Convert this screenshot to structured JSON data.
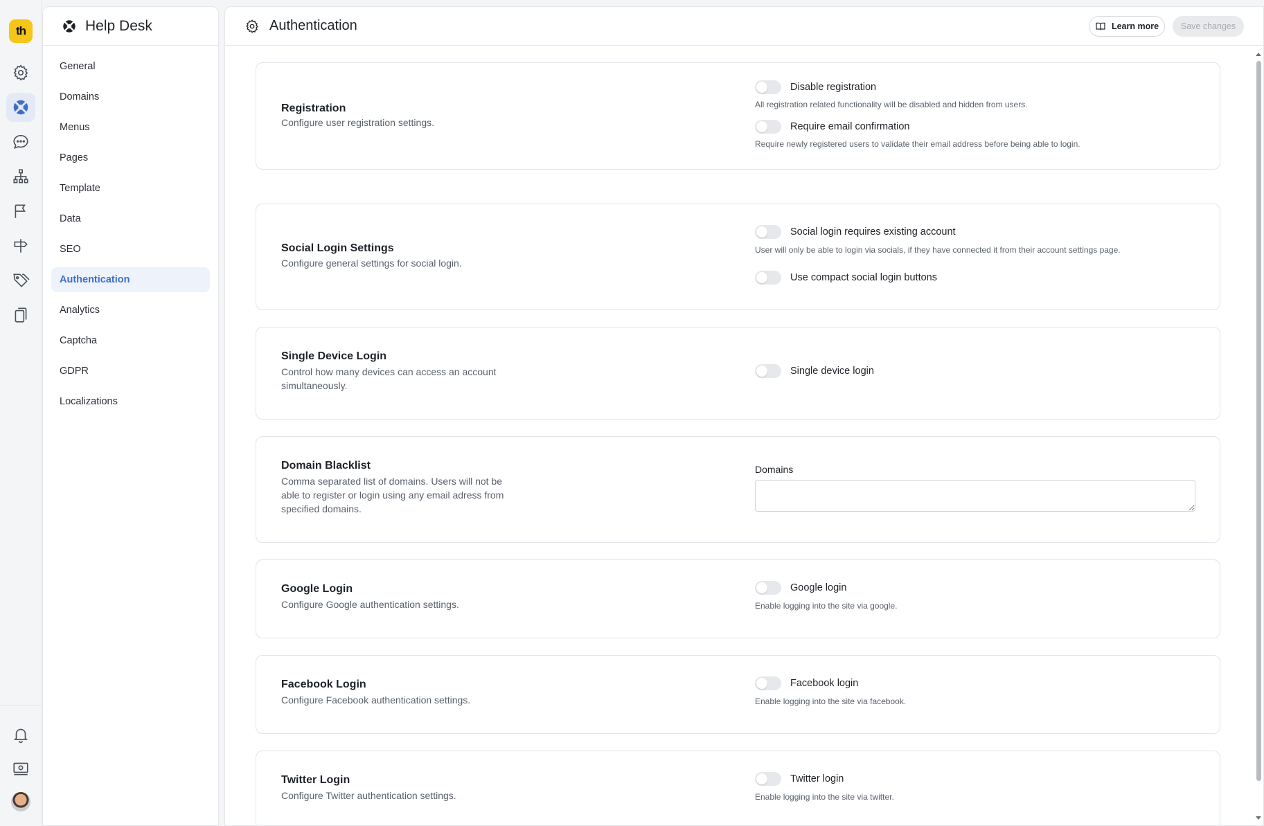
{
  "rail": {
    "logo_text": "th",
    "icons": [
      "settings-icon",
      "help-desk-icon",
      "chat-icon",
      "sitemap-icon",
      "flag-icon",
      "signpost-icon",
      "tags-icon",
      "pages-icon",
      "bell-icon",
      "billing-icon"
    ],
    "active_color": "#3d6fc6"
  },
  "nav": {
    "title": "Help Desk",
    "items": [
      "General",
      "Domains",
      "Menus",
      "Pages",
      "Template",
      "Data",
      "SEO",
      "Authentication",
      "Analytics",
      "Captcha",
      "GDPR",
      "Localizations"
    ],
    "active": "Authentication"
  },
  "header": {
    "title": "Authentication",
    "learn_more": "Learn more",
    "save_changes": "Save changes"
  },
  "sections": {
    "registration": {
      "title": "Registration",
      "desc": "Configure user registration settings.",
      "opt1_label": "Disable registration",
      "opt1_hint": "All registration related functionality will be disabled and hidden from users.",
      "opt2_label": "Require email confirmation",
      "opt2_hint": "Require newly registered users to validate their email address before being able to login."
    },
    "social": {
      "title": "Social Login Settings",
      "desc": "Configure general settings for social login.",
      "opt1_label": "Social login requires existing account",
      "opt1_hint": "User will only be able to login via socials, if they have connected it from their account settings page.",
      "opt2_label": "Use compact social login buttons"
    },
    "single_device": {
      "title": "Single Device Login",
      "desc": "Control how many devices can access an account simultaneously.",
      "opt1_label": "Single device login"
    },
    "blacklist": {
      "title": "Domain Blacklist",
      "desc": "Comma separated list of domains. Users will not be able to register or login using any email adress from specified domains.",
      "field_label": "Domains",
      "field_value": ""
    },
    "google": {
      "title": "Google Login",
      "desc": "Configure Google authentication settings.",
      "opt1_label": "Google login",
      "opt1_hint": "Enable logging into the site via google."
    },
    "facebook": {
      "title": "Facebook Login",
      "desc": "Configure Facebook authentication settings.",
      "opt1_label": "Facebook login",
      "opt1_hint": "Enable logging into the site via facebook."
    },
    "twitter": {
      "title": "Twitter Login",
      "desc": "Configure Twitter authentication settings.",
      "opt1_label": "Twitter login",
      "opt1_hint": "Enable logging into the site via twitter."
    }
  }
}
